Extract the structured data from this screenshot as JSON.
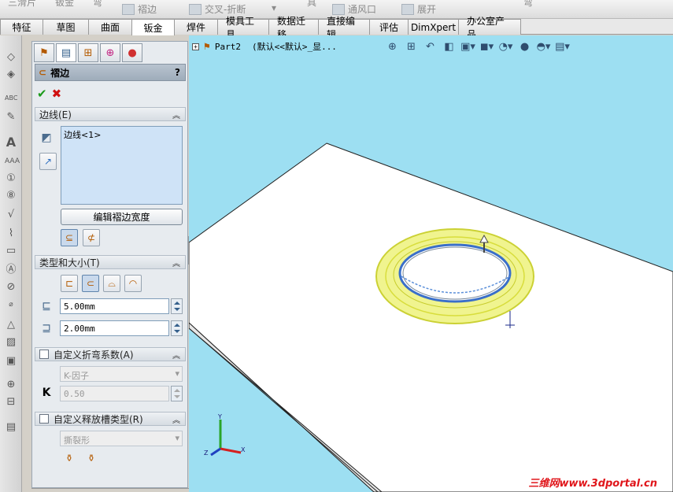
{
  "top_toolbar": {
    "items": [
      "三滑片",
      "钣金",
      "弯",
      "褶边",
      "交叉-折断",
      "具",
      "通风口",
      "展开",
      "弯"
    ]
  },
  "tabs": [
    "特征",
    "草图",
    "曲面",
    "钣金",
    "焊件",
    "模具工具",
    "数据迁移",
    "直接编辑",
    "评估",
    "DimXpert",
    "办公室产品"
  ],
  "active_tab": "钣金",
  "property_manager": {
    "title": "褶边",
    "help": "?",
    "sections": {
      "edges": {
        "header": "边线(E)",
        "list_item": "边线<1>",
        "edit_button": "编辑褶边宽度"
      },
      "type_size": {
        "header": "类型和大小(T)",
        "length_value": "5.00mm",
        "gap_value": "2.00mm"
      },
      "bend_allowance": {
        "header": "自定义折弯系数(A)",
        "select_value": "K-因子",
        "k_label": "K",
        "k_value": "0.50"
      },
      "relief": {
        "header": "自定义释放槽类型(R)",
        "select_value": "撕裂形"
      }
    }
  },
  "feature_tree": {
    "part_label": "Part2",
    "config_label": "(默认<<默认>_显..."
  },
  "triad": {
    "x": "X",
    "y": "Y",
    "z": "Z"
  },
  "watermark": "三维网www.3dportal.cn",
  "colors": {
    "viewport_bg": "#9ddff2",
    "hem_highlight": "#e8f06a",
    "accent_ok": "#1a9a1a",
    "accent_cancel": "#d01010"
  }
}
